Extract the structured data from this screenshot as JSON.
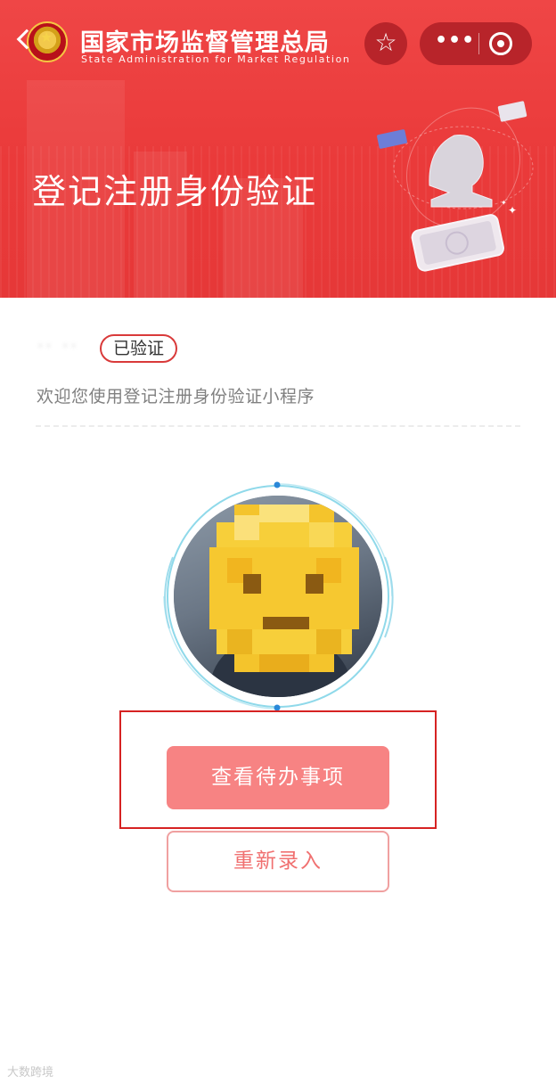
{
  "header": {
    "org_name_cn": "国家市场监督管理总局",
    "org_name_en": "State Administration for Market Regulation",
    "page_title": "登记注册身份验证",
    "star_icon": "☆",
    "more_icon": "•••",
    "brand_color": "#ea3a3a"
  },
  "user": {
    "name_masked": "·· ··",
    "status_badge": "已验证",
    "welcome_text": "欢迎您使用登记注册身份验证小程序"
  },
  "actions": {
    "view_todo_label": "查看待办事项",
    "re_enter_label": "重新录入"
  },
  "watermark": {
    "text": "大数跨境"
  }
}
